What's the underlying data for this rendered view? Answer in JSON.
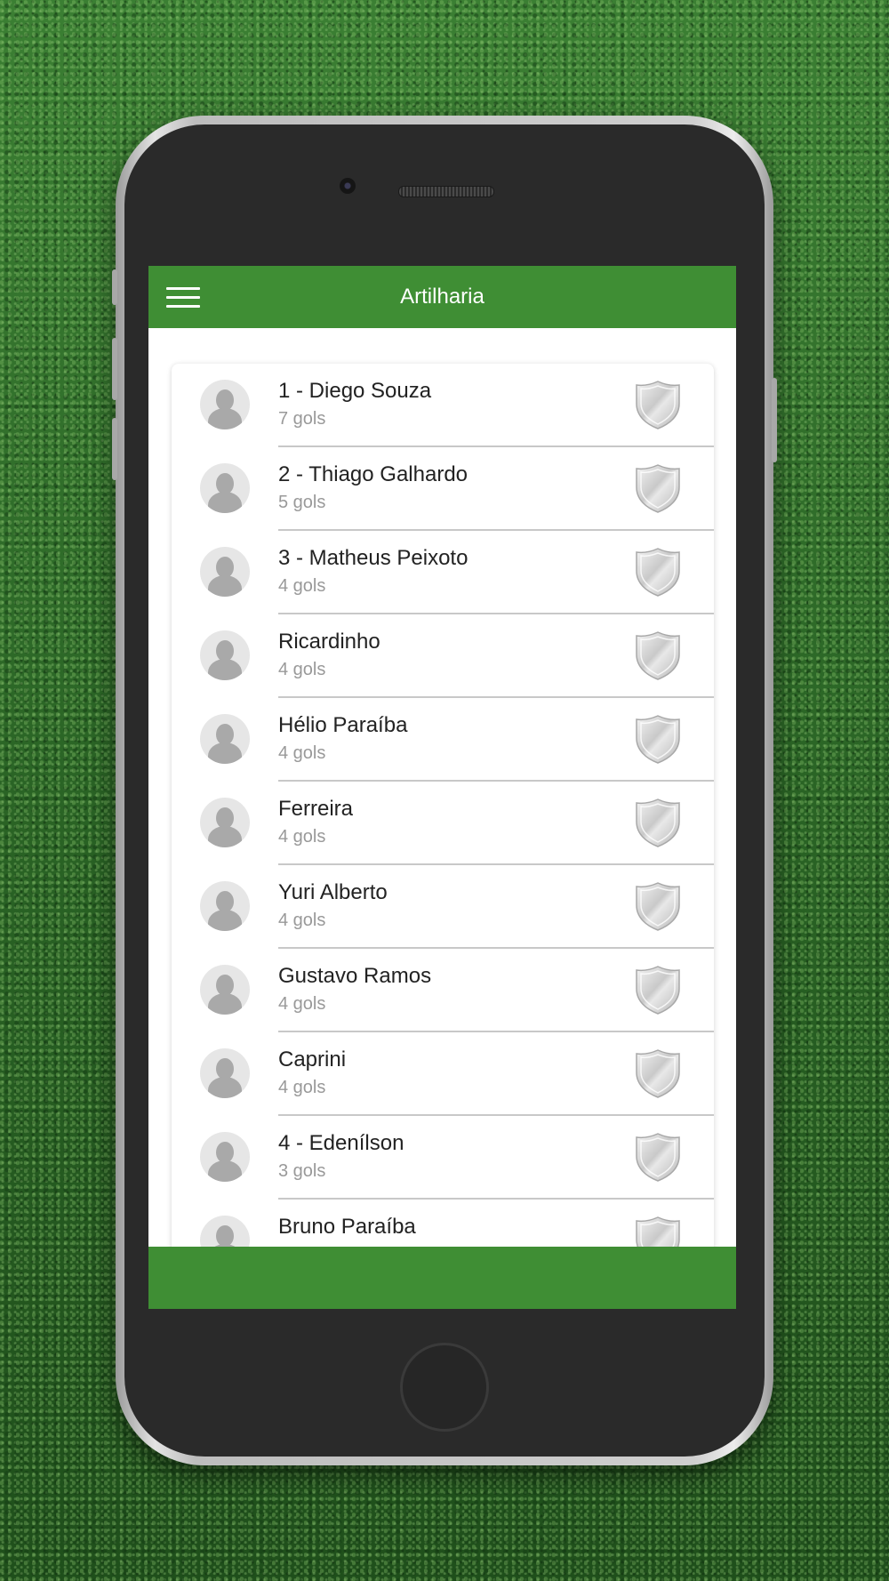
{
  "header": {
    "title": "Artilharia",
    "accent_color": "#3f8e34",
    "menu_icon": "hamburger-menu-icon"
  },
  "scorers": [
    {
      "name": "1 - Diego Souza",
      "goals": "7 gols"
    },
    {
      "name": "2 - Thiago Galhardo",
      "goals": "5 gols"
    },
    {
      "name": "3 - Matheus Peixoto",
      "goals": "4 gols"
    },
    {
      "name": "Ricardinho",
      "goals": "4 gols"
    },
    {
      "name": "Hélio Paraíba",
      "goals": "4 gols"
    },
    {
      "name": "Ferreira",
      "goals": "4 gols"
    },
    {
      "name": "Yuri Alberto",
      "goals": "4 gols"
    },
    {
      "name": "Gustavo Ramos",
      "goals": "4 gols"
    },
    {
      "name": "Caprini",
      "goals": "4 gols"
    },
    {
      "name": "4 - Edenílson",
      "goals": "3 gols"
    },
    {
      "name": "Bruno Paraíba",
      "goals": ""
    }
  ],
  "icons": {
    "avatar": "person-avatar-icon",
    "crest": "team-crest-icon"
  }
}
